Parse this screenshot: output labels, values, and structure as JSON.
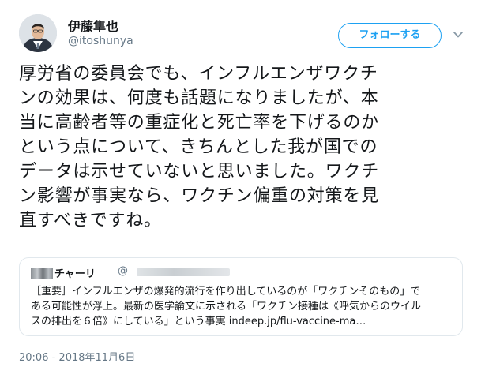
{
  "author": {
    "display_name": "伊藤隼也",
    "handle": "@itoshunya"
  },
  "follow_button_label": "フォローする",
  "tweet": {
    "lines": [
      "厚労省の委員会でも、インフルエンザワクチ",
      "ンの効果は、何度も話題になりましたが、本",
      "当に高齢者等の重症化と死亡率を下げるのか",
      "という点について、きちんとした我が国での",
      "データは示せていないと思いました。ワクチ",
      "ン影響が事実なら、ワクチン偏重の対策を見",
      "直すべきですね。"
    ]
  },
  "quoted_tweet": {
    "name": "チャーリ",
    "handle_prefix": "@",
    "lines": [
      "［重要］インフルエンザの爆発的流行を作り出しているのが「ワクチンそのもの」で",
      "ある可能性が浮上。最新の医学論文に示される「ワクチン接種は《呼気からのウイル",
      "スの排出を６倍》にしている」という事実 indeep.jp/flu-vaccine-ma…"
    ]
  },
  "timestamp": "20:06 - 2018年11月6日",
  "colors": {
    "accent": "#1da1f2",
    "secondary_text": "#657786",
    "border": "#e1e8ed"
  },
  "icons": {
    "menu": "chevron-down-icon",
    "avatar": "profile-photo"
  }
}
